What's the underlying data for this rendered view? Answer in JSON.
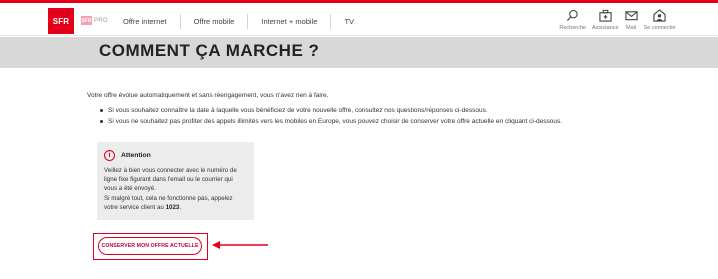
{
  "brand": {
    "logo_text": "SFR",
    "pro_badge": "SFR",
    "pro_label": "PRO",
    "accent_color": "#e2001a"
  },
  "nav": {
    "items": [
      {
        "label": "Offre internet"
      },
      {
        "label": "Offre mobile"
      },
      {
        "label": "Internet + mobile"
      },
      {
        "label": "TV"
      }
    ]
  },
  "actions": [
    {
      "label": "Recherche",
      "icon": "search-icon"
    },
    {
      "label": "Assistance",
      "icon": "toolbox-icon"
    },
    {
      "label": "Mail",
      "icon": "mail-icon"
    },
    {
      "label": "Se connecter",
      "icon": "home-user-icon"
    }
  ],
  "hero": {
    "title": "COMMENT ÇA MARCHE ?"
  },
  "content": {
    "intro": "Votre offre évolue automatiquement et sans réengagement, vous n'avez rien à faire.",
    "bullets": [
      "Si vous souhaitez connaître la date à laquelle vous bénéficiez de votre nouvelle offre, consultez nos questions/réponses ci-dessous.",
      "Si vous ne souhaitez pas profiter des appels illimités vers les mobiles en Europe, vous pouvez choisir de conserver votre offre actuelle en cliquant ci-dessous."
    ]
  },
  "alert": {
    "icon_glyph": "i",
    "title": "Attention",
    "lines": [
      "Veillez à bien vous connecter avec le numéro de",
      "ligne fixe figurant dans l'email ou le courrier qui",
      "vous a été envoyé.",
      "Si malgré tout, cela ne fonctionne pas, appelez"
    ],
    "last_line_prefix": "votre service client au ",
    "phone": "1023",
    "last_line_suffix": "."
  },
  "cta": {
    "label": "CONSERVER MON OFFRE ACTUELLE"
  }
}
